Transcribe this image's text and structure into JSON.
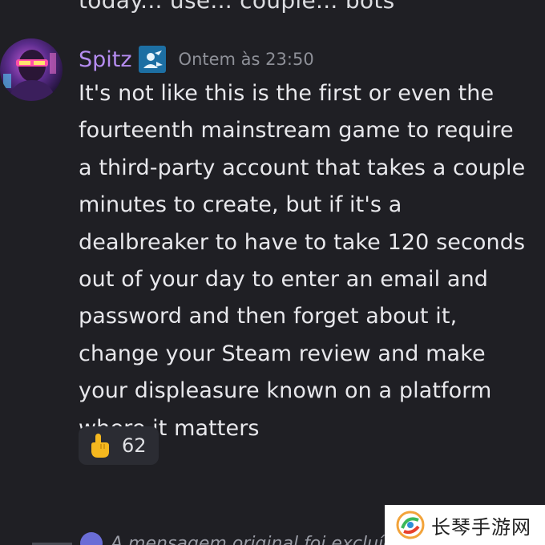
{
  "previous_message": {
    "text": "today... use... couple... bots"
  },
  "message": {
    "username": "Spitz",
    "username_color": "#b58cf0",
    "role_icon": "bird-badge-icon",
    "timestamp": "Ontem às 23:50",
    "lines": [
      "It's not like this is the first or even the",
      "fourteenth mainstream game to require",
      "a third-party account that takes a couple",
      "minutes to create, but if it's a",
      "dealbreaker to have to take 120 seconds",
      "out of your day to enter an email and",
      "password and then forget about it,",
      "change your Steam review and make",
      "your displeasure known on a platform",
      "where it matters"
    ]
  },
  "reaction": {
    "emoji": "pointing-up-hand-emoji",
    "count": "62"
  },
  "reply_preview": {
    "text": "A mensagem original foi excluída"
  },
  "watermark": {
    "text": "长琴手游网"
  },
  "colors": {
    "background": "#1f1f24",
    "reaction_bg": "#2b2c33",
    "timestamp": "#8e9098"
  }
}
